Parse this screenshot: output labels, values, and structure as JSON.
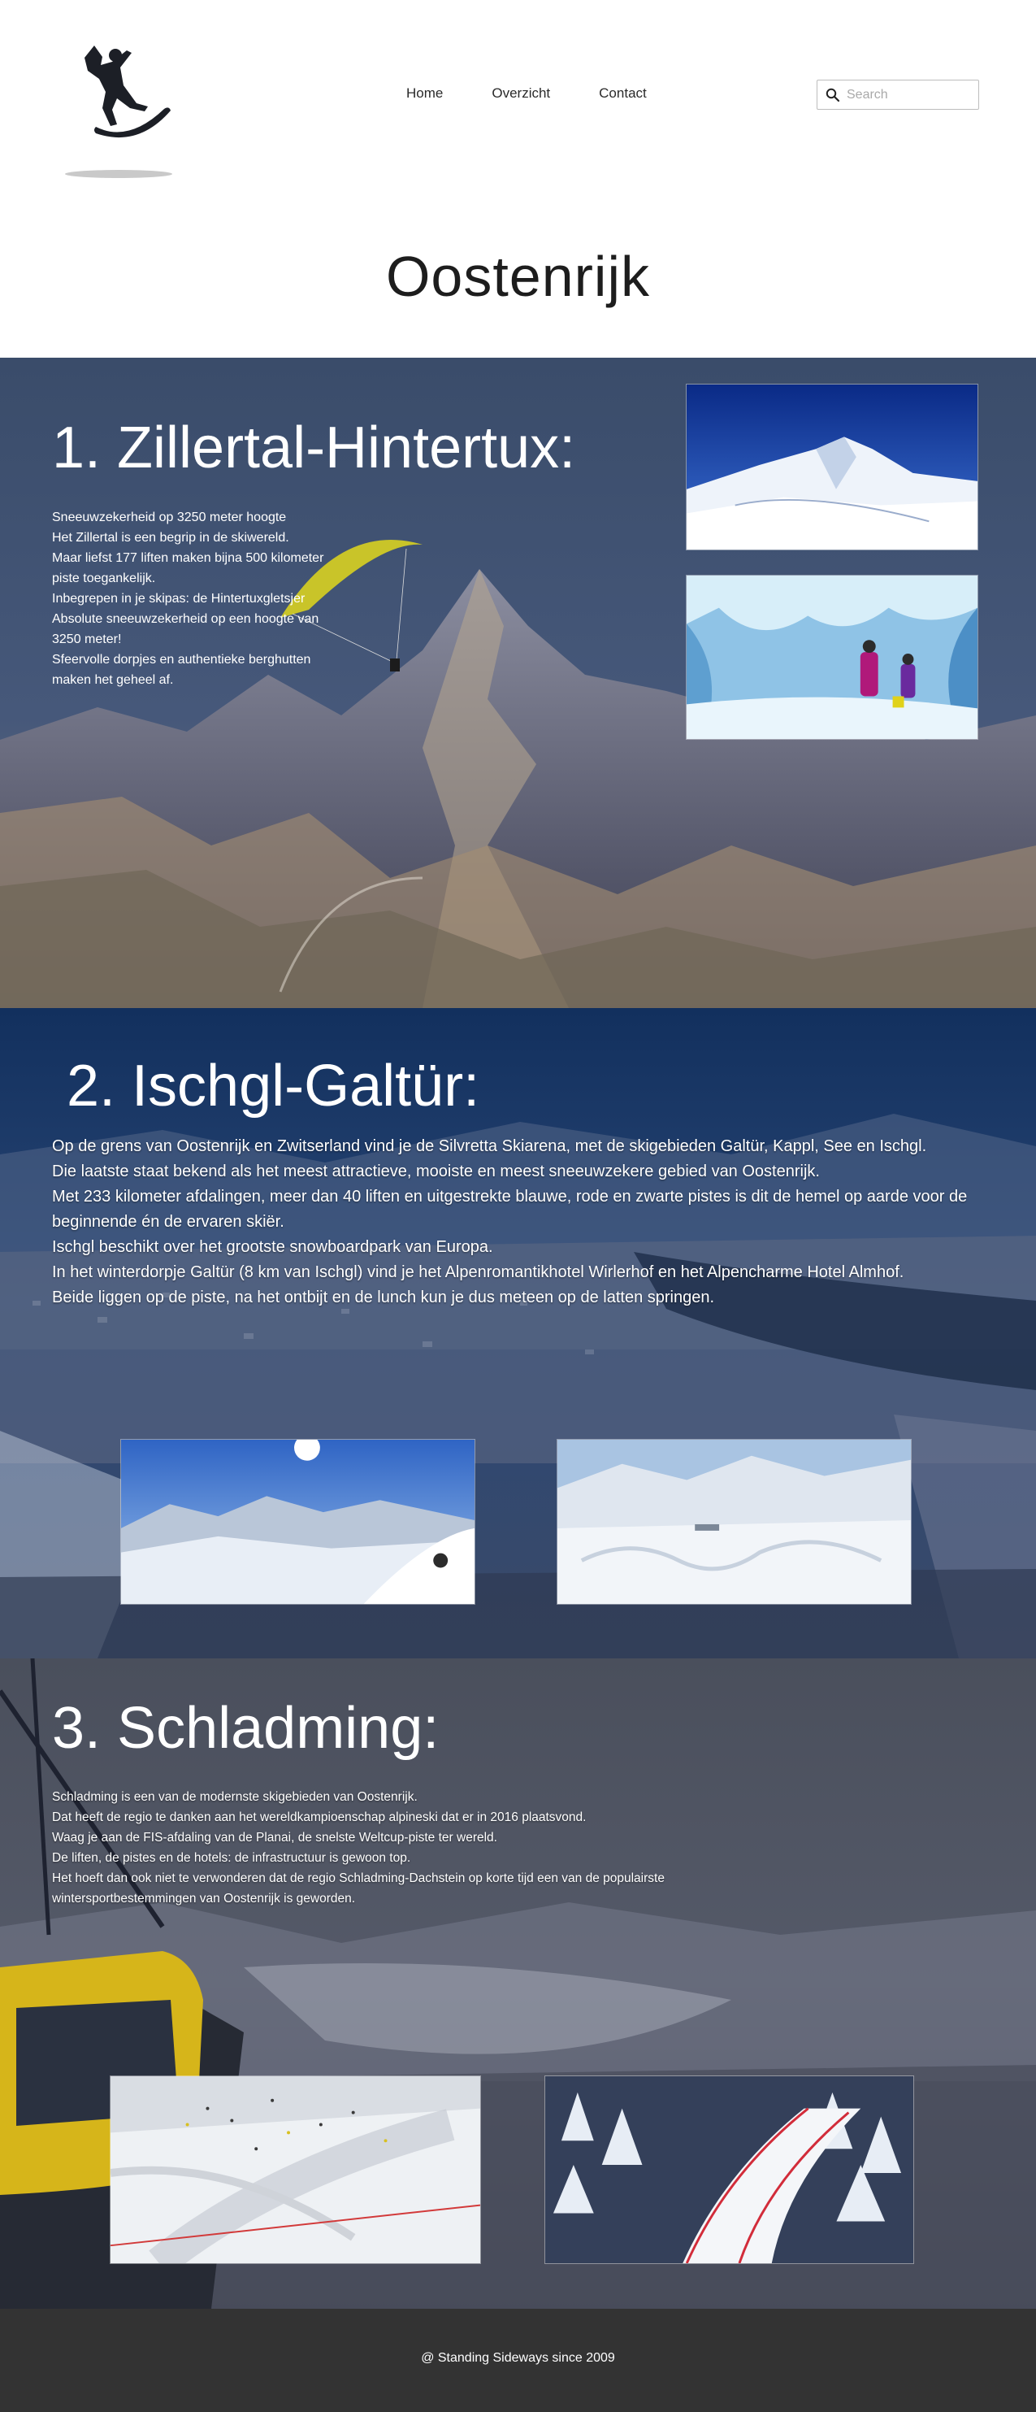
{
  "header": {
    "logo_icon": "snowboarder-logo-icon",
    "nav": [
      "Home",
      "Overzicht",
      "Contact"
    ],
    "search": {
      "placeholder": "Search",
      "value": "",
      "icon": "search-icon"
    }
  },
  "page_title": "Oostenrijk",
  "sections": [
    {
      "title": "1. Zillertal-Hintertux:",
      "lines": [
        "Sneeuwzekerheid op 3250 meter hoogte",
        "Het Zillertal is een begrip in de skiwereld.",
        "Maar liefst 177 liften maken bijna 500 kilometer piste toegankelijk.",
        "Inbegrepen in je skipas: de Hintertuxgletsjer",
        "Absolute sneeuwzekerheid op een hoogte van 3250 meter!",
        "Sfeervolle dorpjes en authentieke berghutten maken het geheel af."
      ],
      "photos": [
        "glacier-peak-photo",
        "ice-cave-photo"
      ]
    },
    {
      "title": "2. Ischgl-Galtür:",
      "lines": [
        "Op de grens van Oostenrijk en Zwitserland vind je de Silvretta Skiarena, met de skigebieden Galtür, Kappl, See en Ischgl.",
        "Die laatste staat bekend als het meest attractieve, mooiste en meest sneeuwzekere gebied van Oostenrijk.",
        "Met 233 kilometer afdalingen, meer dan 40 liften en uitgestrekte blauwe, rode en zwarte pistes is dit de hemel op aarde voor de beginnende én de ervaren skiër.",
        "Ischgl beschikt over het grootste snowboardpark van Europa.",
        "In het winterdorpje Galtür (8 km van Ischgl) vind je het Alpenromantikhotel Wirlerhof en het Alpencharme Hotel Almhof.",
        "Beide liggen op de piste, na het ontbijt en de lunch kun je dus meteen op de latten springen."
      ],
      "photos": [
        "powder-skier-photo",
        "snowpark-photo"
      ]
    },
    {
      "title": "3. Schladming:",
      "lines": [
        "Schladming is een van de modernste skigebieden van Oostenrijk.",
        "Dat heeft de regio te danken aan het wereldkampioenschap alpineski dat er in 2016 plaatsvond.",
        "Waag je aan de FIS-afdaling van de Planai, de snelste Weltcup-piste ter wereld.",
        "De liften, de pistes en de hotels: de infrastructuur is gewoon top.",
        "Het hoeft dan ook niet te verwonderen dat de regio Schladming-Dachstein op korte tijd een van de populairste wintersportbestemmingen van Oostenrijk is geworden."
      ],
      "photos": [
        "ski-slope-crowd-photo",
        "race-course-photo"
      ]
    }
  ],
  "footer": {
    "text": "@ Standing Sideways since 2009"
  }
}
